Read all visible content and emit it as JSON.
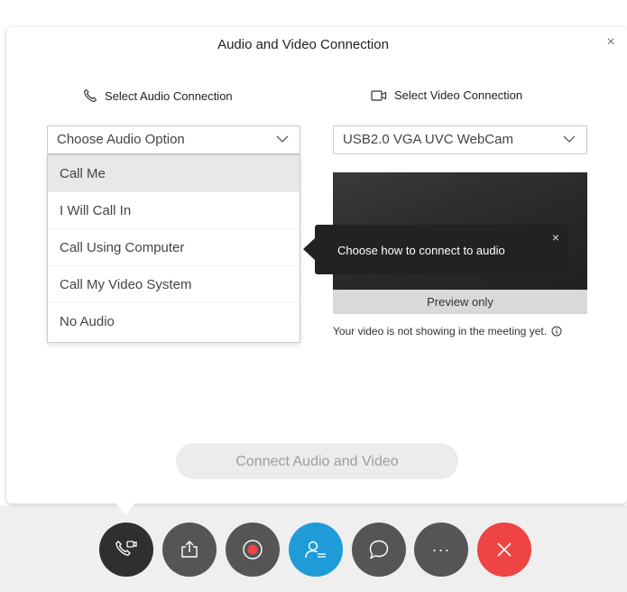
{
  "dialog": {
    "title": "Audio and Video Connection",
    "close_glyph": "×",
    "close_icon": "close-icon"
  },
  "audio": {
    "label": "Select Audio Connection",
    "icon": "phone-icon",
    "select_value": "Choose Audio Option",
    "options": [
      "Call Me",
      "I Will Call In",
      "Call Using Computer",
      "Call My Video System",
      "No Audio"
    ],
    "highlighted_option": "Call Me"
  },
  "video": {
    "label": "Select Video Connection",
    "icon": "video-camera-icon",
    "select_value": "USB2.0 VGA UVC WebCam",
    "preview_caption": "Preview only",
    "note": "Your video is not showing in the meeting yet.",
    "note_icon": "info-icon"
  },
  "tooltip": {
    "text": "Choose how to connect to audio",
    "close_glyph": "×"
  },
  "connect_button": {
    "label": "Connect Audio and Video",
    "disabled": true
  },
  "toolbar": {
    "items": [
      {
        "name": "audio-connection-button",
        "icon": "phone-video-icon",
        "color": "#2f2f2f"
      },
      {
        "name": "share-button",
        "icon": "share-upload-icon",
        "color": "#555555"
      },
      {
        "name": "record-button",
        "icon": "record-icon",
        "color": "#555555"
      },
      {
        "name": "participants-button",
        "icon": "participants-icon",
        "color": "#1f9bd8"
      },
      {
        "name": "chat-button",
        "icon": "chat-bubble-icon",
        "color": "#555555"
      },
      {
        "name": "more-options-button",
        "icon": "more-dots-icon",
        "color": "#555555"
      },
      {
        "name": "leave-meeting-button",
        "icon": "close-icon",
        "color": "#ef4444"
      }
    ],
    "more_glyph": "···",
    "close_glyph": "×"
  },
  "colors": {
    "dark_button": "#2f2f2f",
    "gray_button": "#555555",
    "accent_blue": "#1f9bd8",
    "leave_red": "#ef4444",
    "tooltip_bg": "#222222",
    "disabled_button_bg": "#ececec",
    "disabled_button_text": "#9d9d9d"
  }
}
